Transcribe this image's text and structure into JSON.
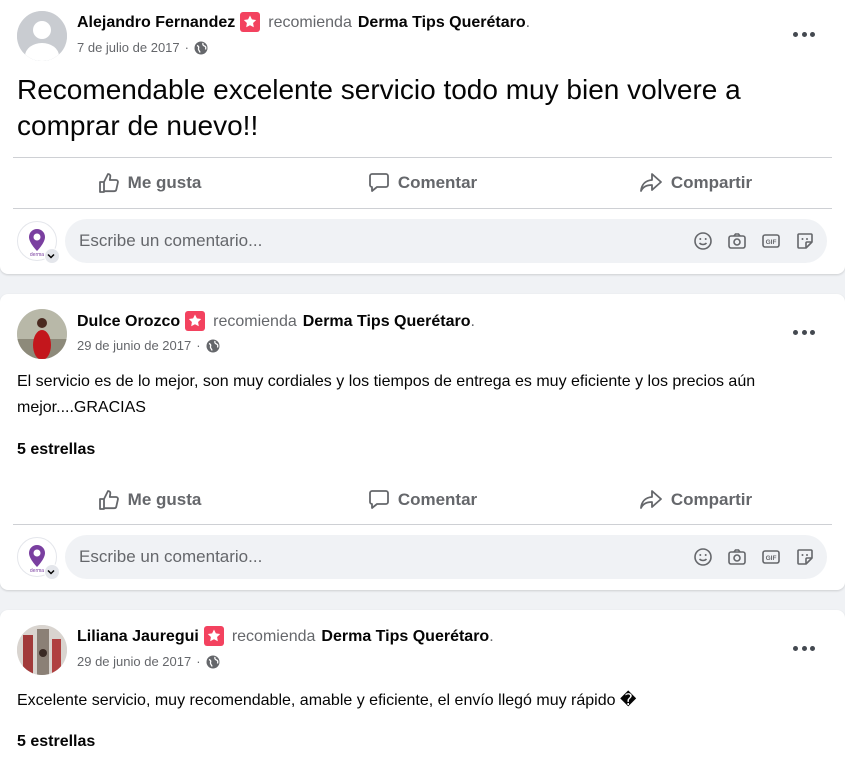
{
  "posts": [
    {
      "author": "Alejandro Fernandez",
      "verb": "recomienda",
      "page": "Derma Tips Querétaro",
      "date": "7 de julio de 2017",
      "text": "Recomendable excelente servicio todo muy bien volvere a comprar de nuevo!!",
      "rating": ""
    },
    {
      "author": "Dulce Orozco",
      "verb": "recomienda",
      "page": "Derma Tips Querétaro",
      "date": "29 de junio de 2017",
      "text": "El servicio es de lo mejor, son muy cordiales y los tiempos de entrega es muy eficiente y los precios aún mejor....GRACIAS",
      "rating": "5 estrellas"
    },
    {
      "author": "Liliana Jauregui",
      "verb": "recomienda",
      "page": "Derma Tips Querétaro",
      "date": "29 de junio de 2017",
      "text": "Excelente servicio, muy recomendable, amable y eficiente, el envío llegó muy rápido �",
      "rating": "5 estrellas"
    }
  ],
  "actions": {
    "like": "Me gusta",
    "comment": "Comentar",
    "share": "Compartir"
  },
  "comment_box": {
    "placeholder": "Escribe un comentario..."
  },
  "icons": [
    "profile-avatar",
    "recommend-badge-icon",
    "globe-icon",
    "more-options-icon",
    "like-icon",
    "comment-icon",
    "share-icon",
    "emoji-icon",
    "camera-icon",
    "gif-icon",
    "sticker-icon"
  ],
  "colors": {
    "badge": "#f3425f",
    "secondary_text": "#65676b",
    "page_bg": "#f0f2f5"
  }
}
